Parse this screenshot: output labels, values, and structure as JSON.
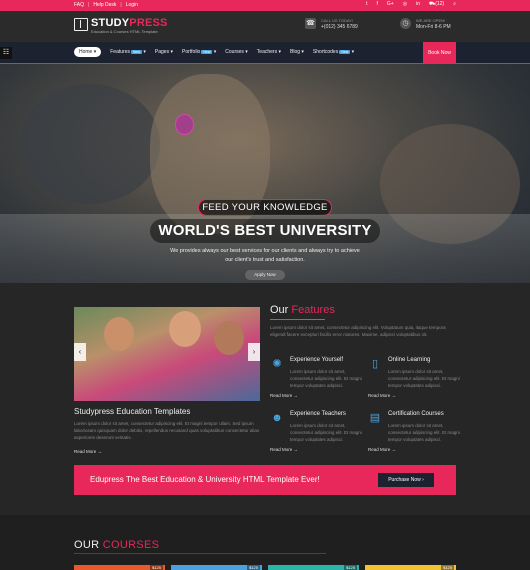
{
  "topbar": {
    "links": [
      "FAQ",
      "Help Desk",
      "Login"
    ],
    "social_icons": [
      "twitter-icon",
      "facebook-icon",
      "google-plus-icon",
      "instagram-icon",
      "linkedin-icon"
    ],
    "cart": "(12)"
  },
  "header": {
    "logo_main": "STUDY",
    "logo_accent": "PRESS",
    "logo_sub": "Education & Courses HTML Template",
    "call_label": "CALL US TODAY!",
    "call_value": "+(012) 345 6789",
    "open_label": "WE ARE OPEN!",
    "open_value": "Mon-Fri 8-6 PM"
  },
  "nav": {
    "items": [
      {
        "label": "Home",
        "active": true,
        "badge": ""
      },
      {
        "label": "Features",
        "badge": "New"
      },
      {
        "label": "Pages",
        "badge": ""
      },
      {
        "label": "Portfolio",
        "badge": "New"
      },
      {
        "label": "Courses",
        "badge": ""
      },
      {
        "label": "Teachers",
        "badge": ""
      },
      {
        "label": "Blog",
        "badge": ""
      },
      {
        "label": "Shortcodes",
        "badge": "New"
      }
    ],
    "book_now": "Book Now"
  },
  "hero": {
    "tagline": "FEED YOUR KNOWLEDGE",
    "title": "WORLD'S BEST UNIVERSITY",
    "description": "We provides always our best services for our clients and always try to achieve our client's trust and satisfaction.",
    "apply_label": "Apply Now"
  },
  "education": {
    "title": "Studypress Education Templates",
    "text": "Lorem ipsum dolor sit amet, consectetur adipiscing elit. Et magni tempor ullam. Sed ipsum laboriosam quisquam dolor debitis, repellendus recusand quas voluptatibus consectetur alias asperiores deserunt veritatis.",
    "read_more": "Read More →"
  },
  "features": {
    "heading_plain": "Our",
    "heading_accent": "Features",
    "intro": "Lorem ipsum dolor sit amet, consectetur adipiscing elit. Voluptatum quia, itaque tempora eligendi facere excepturi facilis error maiores. Maxime, adipisci voluptatibus sit.",
    "items": [
      {
        "title": "Experience Yourself",
        "text": "Lorem ipsum dolor sit amet, consectetur adipiscing elit. Et magni tempor voluptates adipisci.",
        "read_more": "Read More →",
        "icon": "lightbulb-icon"
      },
      {
        "title": "Online Learning",
        "text": "Lorem ipsum dolor sit amet, consectetur adipiscing elit. Et magni tempor voluptates adipisci.",
        "read_more": "Read More →",
        "icon": "mobile-icon"
      },
      {
        "title": "Experience Teachers",
        "text": "Lorem ipsum dolor sit amet, consectetur adipiscing elit. Et magni tempor voluptates adipisci.",
        "read_more": "Read More →",
        "icon": "users-icon"
      },
      {
        "title": "Certification Courses",
        "text": "Lorem ipsum dolor sit amet, consectetur adipiscing elit. Et magni tempor voluptates adipisci.",
        "read_more": "Read More →",
        "icon": "certificate-icon"
      }
    ]
  },
  "cta": {
    "text": "Edupress The Best Education & University HTML Template Ever!",
    "button": "Purchase Now"
  },
  "courses": {
    "heading_plain": "OUR",
    "heading_accent": "COURSES",
    "prices": [
      "$125",
      "$125",
      "$125",
      "$125"
    ],
    "thumb_colors": [
      "#e85a2b",
      "#4aa3df",
      "#2bb5a8",
      "#f2c230"
    ]
  },
  "colors": {
    "accent": "#e8275a",
    "nav_bg": "#1d2231",
    "icon_blue": "#4aa3df"
  }
}
